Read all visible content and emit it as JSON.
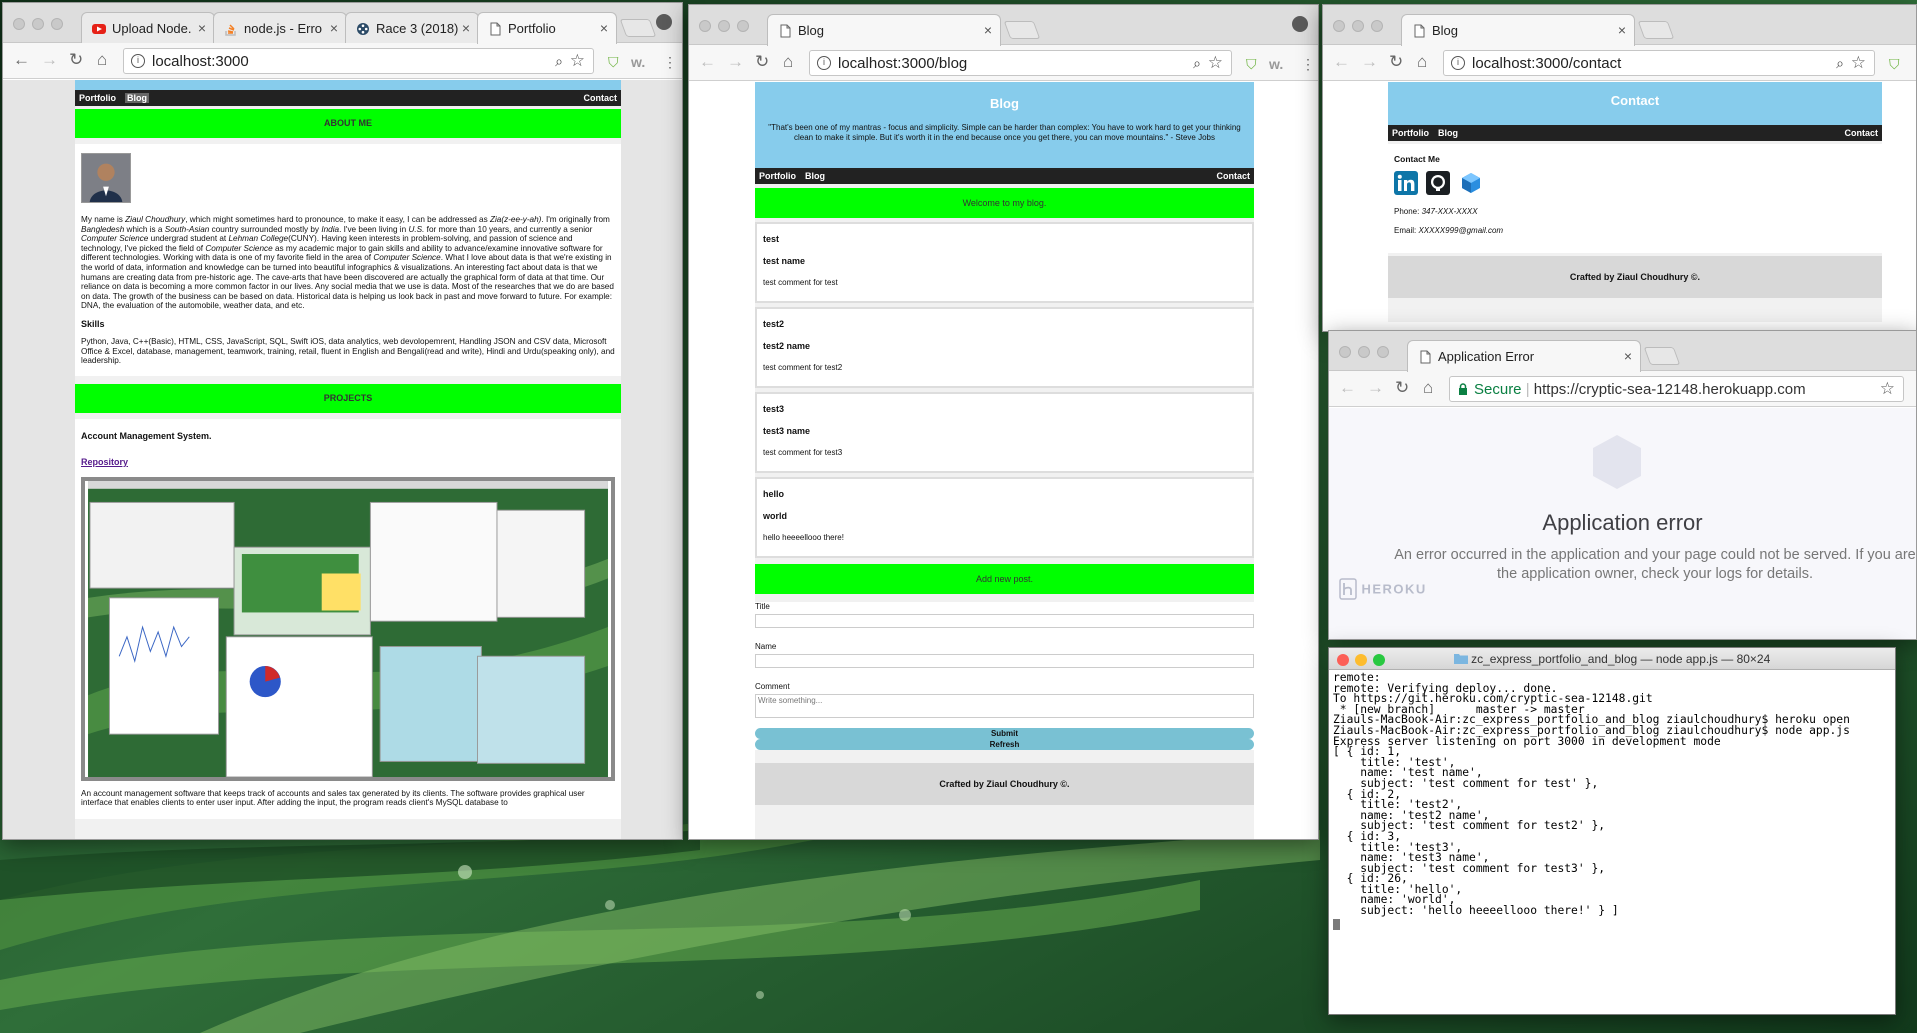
{
  "window1": {
    "tabs": [
      {
        "label": "Upload Node.",
        "icon": "youtube-icon"
      },
      {
        "label": "node.js - Erro",
        "icon": "stackoverflow-icon"
      },
      {
        "label": "Race 3 (2018)",
        "icon": "film-reel-icon"
      },
      {
        "label": "Portfolio",
        "icon": "page-icon"
      }
    ],
    "url": "localhost:3000",
    "page": {
      "nav": [
        "Portfolio",
        "Blog"
      ],
      "nav_right": "Contact",
      "about_heading": "ABOUT ME",
      "bio": [
        "My name is ",
        "Ziaul Choudhury",
        ", which might sometimes hard to pronounce, to make it easy, I can be addressed as ",
        "Zia(z-ee-y-ah)",
        ". I'm originally from ",
        "Bangledesh",
        " which is a ",
        "South-Asian",
        " country surrounded mostly by ",
        "India",
        ". I've been living in ",
        "U.S.",
        " for more than 10 years, and currently a senior ",
        "Computer Science",
        " undergrad student at ",
        "Lehman College",
        "(CUNY). Having keen interests in problem-solving, and passion of science and technology, I've picked the field of ",
        "Computer Science",
        " as my academic major to gain skills and ability to advance/examine innovative software for different technologies. Working with data is one of my favorite field in the area of ",
        "Computer Science",
        ". What I love about data is that we're existing in the world of data, information and knowledge can be turned into beautiful infographics & visualizations. An interesting fact about data is that we humans are creating data from pre-historic age. The cave-arts that have been discovered are actually the graphical form of data at that time. Our reliance on data is becoming a more common factor in our lives. Any social media that we use is data. Most of the researches that we do are based on data. The growth of the business can be based on data. Historical data is helping us look back in past and move forward to future. For example: DNA, the evaluation of the automobile, weather data, and etc."
      ],
      "skills_heading": "Skills",
      "skills": "Python, Java, C++(Basic), HTML, CSS, JavaScript, SQL, Swift iOS, data analytics, web devolopemrent, Handling JSON and CSV data, Microsoft Office & Excel, database, management, teamwork, training, retail, fluent in English and Bengali(read and write), Hindi and Urdu(speaking only), and leadership.",
      "projects_heading": "PROJECTS",
      "project_title": "Account Management System.",
      "repo_link": "Repository",
      "project_desc": "An account management software that keeps track of accounts and sales tax generated by its clients. The software provides graphical user interface that enables clients to enter user input. After adding the input, the program reads client's MySQL database to"
    }
  },
  "window2": {
    "tabs": [
      {
        "label": "Blog",
        "icon": "page-icon"
      }
    ],
    "url": "localhost:3000/blog",
    "page": {
      "title": "Blog",
      "quote": "\"That's been one of my mantras - focus and simplicity. Simple can be harder than complex: You have to work hard to get your thinking clean to make it simple. But it's worth it in the end because once you get there, you can move mountains.\" - Steve Jobs",
      "nav": [
        "Portfolio",
        "Blog"
      ],
      "nav_right": "Contact",
      "welcome": "Welcome to my blog.",
      "posts": [
        {
          "title": "test",
          "name": "test name",
          "comment": "test comment for test"
        },
        {
          "title": "test2",
          "name": "test2 name",
          "comment": "test comment for test2"
        },
        {
          "title": "test3",
          "name": "test3 name",
          "comment": "test comment for test3"
        },
        {
          "title": "hello",
          "name": "world",
          "comment": "hello heeeellooo there!"
        }
      ],
      "add_post": "Add new post.",
      "title_label": "Title",
      "name_label": "Name",
      "comment_label": "Comment",
      "comment_placeholder": "Write something...",
      "submit": "Submit",
      "refresh": "Refresh",
      "footer": "Crafted by Ziaul Choudhury ©."
    }
  },
  "window3": {
    "tabs": [
      {
        "label": "Blog",
        "icon": "page-icon"
      }
    ],
    "url": "localhost:3000/contact",
    "page": {
      "title": "Contact",
      "nav": [
        "Portfolio",
        "Blog"
      ],
      "nav_right": "Contact",
      "contact_heading": "Contact Me",
      "phone_label": "Phone: ",
      "phone": "347-XXX-XXXX",
      "email_label": "Email: ",
      "email": "XXXXX999@gmail.com",
      "footer": "Crafted by Ziaul Choudhury ©."
    }
  },
  "window4": {
    "tabs": [
      {
        "label": "Application Error",
        "icon": "page-icon"
      }
    ],
    "secure": "Secure",
    "url": "https://cryptic-sea-12148.herokuapp.com",
    "heading": "Application error",
    "message": "An error occurred in the application and your page could not be served. If you are the application owner, check your logs for details.",
    "brand": "HEROKU"
  },
  "terminal": {
    "title": "zc_express_portfolio_and_blog — node app.js — 80×24",
    "lines": [
      "remote:",
      "remote: Verifying deploy... done.",
      "To https://git.heroku.com/cryptic-sea-12148.git",
      " * [new branch]      master -> master",
      "Ziauls-MacBook-Air:zc_express_portfolio_and_blog ziaulchoudhury$ heroku open",
      "Ziauls-MacBook-Air:zc_express_portfolio_and_blog ziaulchoudhury$ node app.js",
      "Express server listening on port 3000 in development mode",
      "[ { id: 1,",
      "    title: 'test',",
      "    name: 'test name',",
      "    subject: 'test comment for test' },",
      "  { id: 2,",
      "    title: 'test2',",
      "    name: 'test2 name',",
      "    subject: 'test comment for test2' },",
      "  { id: 3,",
      "    title: 'test3',",
      "    name: 'test3 name',",
      "    subject: 'test comment for test3' },",
      "  { id: 26,",
      "    title: 'hello',",
      "    name: 'world',",
      "    subject: 'hello heeeellooo there!' } ]"
    ]
  },
  "colors": {
    "header_blue": "#87ccec",
    "bar_green": "#00ff00",
    "nav_dark": "#222222",
    "linkedin": "#0e76a8",
    "github": "#1b1f23"
  }
}
